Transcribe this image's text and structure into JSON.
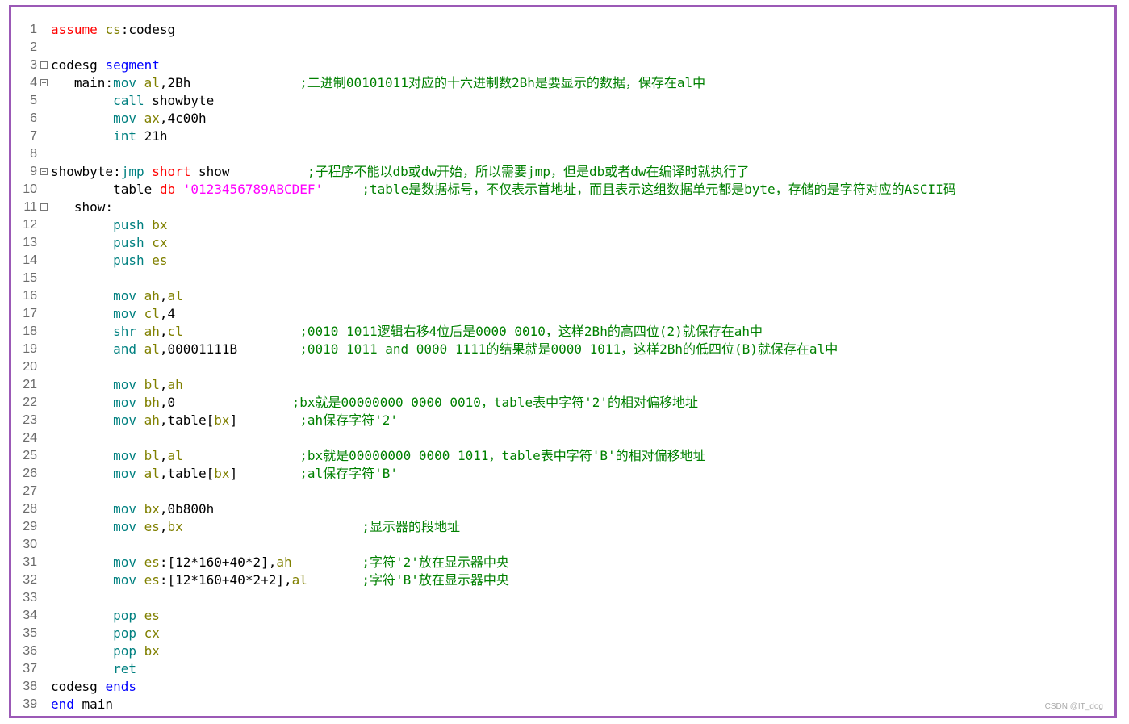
{
  "editor": {
    "lines": [
      {
        "n": "1",
        "fold": false,
        "segs": [
          {
            "t": "assume ",
            "c": "red"
          },
          {
            "t": "cs",
            "c": "reg"
          },
          {
            "t": ":codesg",
            "c": ""
          }
        ]
      },
      {
        "n": "2",
        "fold": false,
        "segs": []
      },
      {
        "n": "3",
        "fold": true,
        "segs": [
          {
            "t": "codesg ",
            "c": ""
          },
          {
            "t": "segment",
            "c": "kw"
          }
        ]
      },
      {
        "n": "4",
        "fold": true,
        "segs": [
          {
            "t": "   main:",
            "c": ""
          },
          {
            "t": "mov ",
            "c": "ins"
          },
          {
            "t": "al",
            "c": "reg"
          },
          {
            "t": ",2Bh              ",
            "c": ""
          },
          {
            "t": ";二进制00101011对应的十六进制数2Bh是要显示的数据，保存在al中",
            "c": "cm"
          }
        ]
      },
      {
        "n": "5",
        "fold": false,
        "segs": [
          {
            "t": "        ",
            "c": ""
          },
          {
            "t": "call ",
            "c": "ins"
          },
          {
            "t": "showbyte",
            "c": ""
          }
        ]
      },
      {
        "n": "6",
        "fold": false,
        "segs": [
          {
            "t": "        ",
            "c": ""
          },
          {
            "t": "mov ",
            "c": "ins"
          },
          {
            "t": "ax",
            "c": "reg"
          },
          {
            "t": ",4c00h",
            "c": ""
          }
        ]
      },
      {
        "n": "7",
        "fold": false,
        "segs": [
          {
            "t": "        ",
            "c": ""
          },
          {
            "t": "int ",
            "c": "ins"
          },
          {
            "t": "21h",
            "c": ""
          }
        ]
      },
      {
        "n": "8",
        "fold": false,
        "segs": []
      },
      {
        "n": "9",
        "fold": true,
        "segs": [
          {
            "t": "showbyte:",
            "c": ""
          },
          {
            "t": "jmp ",
            "c": "ins"
          },
          {
            "t": "short ",
            "c": "red"
          },
          {
            "t": "show          ",
            "c": ""
          },
          {
            "t": ";子程序不能以db或dw开始，所以需要jmp，但是db或者dw在编译时就执行了",
            "c": "cm"
          }
        ]
      },
      {
        "n": "10",
        "fold": false,
        "segs": [
          {
            "t": "        table ",
            "c": ""
          },
          {
            "t": "db ",
            "c": "red"
          },
          {
            "t": "'0123456789ABCDEF'",
            "c": "str"
          },
          {
            "t": "     ",
            "c": ""
          },
          {
            "t": ";table是数据标号，不仅表示首地址，而且表示这组数据单元都是byte，存储的是字符对应的ASCII码",
            "c": "cm"
          }
        ]
      },
      {
        "n": "11",
        "fold": true,
        "segs": [
          {
            "t": "   show:",
            "c": ""
          }
        ]
      },
      {
        "n": "12",
        "fold": false,
        "segs": [
          {
            "t": "        ",
            "c": ""
          },
          {
            "t": "push ",
            "c": "ins"
          },
          {
            "t": "bx",
            "c": "reg"
          }
        ]
      },
      {
        "n": "13",
        "fold": false,
        "segs": [
          {
            "t": "        ",
            "c": ""
          },
          {
            "t": "push ",
            "c": "ins"
          },
          {
            "t": "cx",
            "c": "reg"
          }
        ]
      },
      {
        "n": "14",
        "fold": false,
        "segs": [
          {
            "t": "        ",
            "c": ""
          },
          {
            "t": "push ",
            "c": "ins"
          },
          {
            "t": "es",
            "c": "reg"
          }
        ]
      },
      {
        "n": "15",
        "fold": false,
        "segs": []
      },
      {
        "n": "16",
        "fold": false,
        "segs": [
          {
            "t": "        ",
            "c": ""
          },
          {
            "t": "mov ",
            "c": "ins"
          },
          {
            "t": "ah",
            "c": "reg"
          },
          {
            "t": ",",
            "c": ""
          },
          {
            "t": "al",
            "c": "reg"
          }
        ]
      },
      {
        "n": "17",
        "fold": false,
        "segs": [
          {
            "t": "        ",
            "c": ""
          },
          {
            "t": "mov ",
            "c": "ins"
          },
          {
            "t": "cl",
            "c": "reg"
          },
          {
            "t": ",4",
            "c": ""
          }
        ]
      },
      {
        "n": "18",
        "fold": false,
        "segs": [
          {
            "t": "        ",
            "c": ""
          },
          {
            "t": "shr ",
            "c": "ins"
          },
          {
            "t": "ah",
            "c": "reg"
          },
          {
            "t": ",",
            "c": ""
          },
          {
            "t": "cl",
            "c": "reg"
          },
          {
            "t": "               ",
            "c": ""
          },
          {
            "t": ";0010 1011逻辑右移4位后是0000 0010，这样2Bh的高四位(2)就保存在ah中",
            "c": "cm"
          }
        ]
      },
      {
        "n": "19",
        "fold": false,
        "segs": [
          {
            "t": "        ",
            "c": ""
          },
          {
            "t": "and ",
            "c": "ins"
          },
          {
            "t": "al",
            "c": "reg"
          },
          {
            "t": ",00001111B        ",
            "c": ""
          },
          {
            "t": ";0010 1011 and 0000 1111的结果就是0000 1011，这样2Bh的低四位(B)就保存在al中",
            "c": "cm"
          }
        ]
      },
      {
        "n": "20",
        "fold": false,
        "segs": []
      },
      {
        "n": "21",
        "fold": false,
        "segs": [
          {
            "t": "        ",
            "c": ""
          },
          {
            "t": "mov ",
            "c": "ins"
          },
          {
            "t": "bl",
            "c": "reg"
          },
          {
            "t": ",",
            "c": ""
          },
          {
            "t": "ah",
            "c": "reg"
          }
        ]
      },
      {
        "n": "22",
        "fold": false,
        "segs": [
          {
            "t": "        ",
            "c": ""
          },
          {
            "t": "mov ",
            "c": "ins"
          },
          {
            "t": "bh",
            "c": "reg"
          },
          {
            "t": ",0               ",
            "c": ""
          },
          {
            "t": ";bx就是00000000 0000 0010，table表中字符'2'的相对偏移地址",
            "c": "cm"
          }
        ]
      },
      {
        "n": "23",
        "fold": false,
        "segs": [
          {
            "t": "        ",
            "c": ""
          },
          {
            "t": "mov ",
            "c": "ins"
          },
          {
            "t": "ah",
            "c": "reg"
          },
          {
            "t": ",table[",
            "c": ""
          },
          {
            "t": "bx",
            "c": "reg"
          },
          {
            "t": "]        ",
            "c": ""
          },
          {
            "t": ";ah保存字符'2'",
            "c": "cm"
          }
        ]
      },
      {
        "n": "24",
        "fold": false,
        "segs": []
      },
      {
        "n": "25",
        "fold": false,
        "segs": [
          {
            "t": "        ",
            "c": ""
          },
          {
            "t": "mov ",
            "c": "ins"
          },
          {
            "t": "bl",
            "c": "reg"
          },
          {
            "t": ",",
            "c": ""
          },
          {
            "t": "al",
            "c": "reg"
          },
          {
            "t": "               ",
            "c": ""
          },
          {
            "t": ";bx就是00000000 0000 1011，table表中字符'B'的相对偏移地址",
            "c": "cm"
          }
        ]
      },
      {
        "n": "26",
        "fold": false,
        "segs": [
          {
            "t": "        ",
            "c": ""
          },
          {
            "t": "mov ",
            "c": "ins"
          },
          {
            "t": "al",
            "c": "reg"
          },
          {
            "t": ",table[",
            "c": ""
          },
          {
            "t": "bx",
            "c": "reg"
          },
          {
            "t": "]        ",
            "c": ""
          },
          {
            "t": ";al保存字符'B'",
            "c": "cm"
          }
        ]
      },
      {
        "n": "27",
        "fold": false,
        "segs": []
      },
      {
        "n": "28",
        "fold": false,
        "segs": [
          {
            "t": "        ",
            "c": ""
          },
          {
            "t": "mov ",
            "c": "ins"
          },
          {
            "t": "bx",
            "c": "reg"
          },
          {
            "t": ",0b800h",
            "c": ""
          }
        ]
      },
      {
        "n": "29",
        "fold": false,
        "segs": [
          {
            "t": "        ",
            "c": ""
          },
          {
            "t": "mov ",
            "c": "ins"
          },
          {
            "t": "es",
            "c": "reg"
          },
          {
            "t": ",",
            "c": ""
          },
          {
            "t": "bx",
            "c": "reg"
          },
          {
            "t": "                       ",
            "c": ""
          },
          {
            "t": ";显示器的段地址",
            "c": "cm"
          }
        ]
      },
      {
        "n": "30",
        "fold": false,
        "segs": []
      },
      {
        "n": "31",
        "fold": false,
        "segs": [
          {
            "t": "        ",
            "c": ""
          },
          {
            "t": "mov ",
            "c": "ins"
          },
          {
            "t": "es",
            "c": "reg"
          },
          {
            "t": ":[12*160+40*2],",
            "c": ""
          },
          {
            "t": "ah",
            "c": "reg"
          },
          {
            "t": "         ",
            "c": ""
          },
          {
            "t": ";字符'2'放在显示器中央",
            "c": "cm"
          }
        ]
      },
      {
        "n": "32",
        "fold": false,
        "segs": [
          {
            "t": "        ",
            "c": ""
          },
          {
            "t": "mov ",
            "c": "ins"
          },
          {
            "t": "es",
            "c": "reg"
          },
          {
            "t": ":[12*160+40*2+2],",
            "c": ""
          },
          {
            "t": "al",
            "c": "reg"
          },
          {
            "t": "       ",
            "c": ""
          },
          {
            "t": ";字符'B'放在显示器中央",
            "c": "cm"
          }
        ]
      },
      {
        "n": "33",
        "fold": false,
        "segs": []
      },
      {
        "n": "34",
        "fold": false,
        "segs": [
          {
            "t": "        ",
            "c": ""
          },
          {
            "t": "pop ",
            "c": "ins"
          },
          {
            "t": "es",
            "c": "reg"
          }
        ]
      },
      {
        "n": "35",
        "fold": false,
        "segs": [
          {
            "t": "        ",
            "c": ""
          },
          {
            "t": "pop ",
            "c": "ins"
          },
          {
            "t": "cx",
            "c": "reg"
          }
        ]
      },
      {
        "n": "36",
        "fold": false,
        "segs": [
          {
            "t": "        ",
            "c": ""
          },
          {
            "t": "pop ",
            "c": "ins"
          },
          {
            "t": "bx",
            "c": "reg"
          }
        ]
      },
      {
        "n": "37",
        "fold": false,
        "segs": [
          {
            "t": "        ",
            "c": ""
          },
          {
            "t": "ret",
            "c": "ins"
          }
        ]
      },
      {
        "n": "38",
        "fold": false,
        "segs": [
          {
            "t": "codesg ",
            "c": ""
          },
          {
            "t": "ends",
            "c": "kw"
          }
        ]
      },
      {
        "n": "39",
        "fold": false,
        "segs": [
          {
            "t": "end ",
            "c": "kw"
          },
          {
            "t": "main",
            "c": ""
          }
        ]
      }
    ]
  },
  "watermark": "CSDN @IT_dog"
}
